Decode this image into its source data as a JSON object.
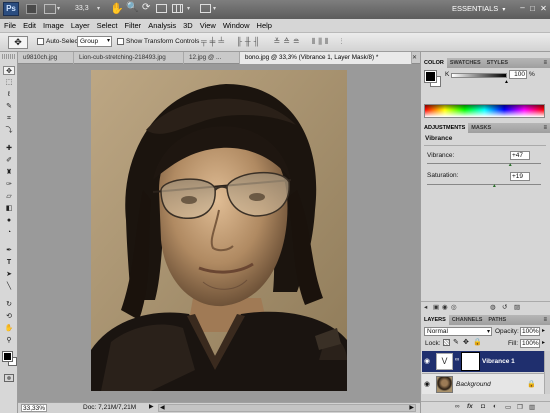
{
  "app": {
    "logo": "Ps",
    "zoom": "33,3",
    "workspace_button": "ESSENTIALS",
    "colors": {
      "appbar": "#6b6b6b",
      "logo_bg": "#2b4d80",
      "layer_selected": "#1f2f6e"
    }
  },
  "menu": [
    "File",
    "Edit",
    "Image",
    "Layer",
    "Select",
    "Filter",
    "Analysis",
    "3D",
    "View",
    "Window",
    "Help"
  ],
  "options": {
    "auto_select_label": "Auto-Select:",
    "auto_select_value": "Group",
    "transform_label": "Show Transform Controls"
  },
  "doc_tabs": [
    {
      "label": "u9810ch.jpg"
    },
    {
      "label": "Lion-cub-stretching-218493.jpg"
    },
    {
      "label": "12.jpg @ ..."
    },
    {
      "label": "bono.jpg @ 33,3% (Vibrance 1, Layer Mask/8) *"
    }
  ],
  "status": {
    "zoom": "33,33%",
    "doc": "Doc: 7,21M/7,21M"
  },
  "color_panel": {
    "tabs": [
      "COLOR",
      "SWATCHES",
      "STYLES"
    ],
    "channel": "K",
    "value": "100",
    "unit": "%",
    "k_fraction": 1.0
  },
  "adjustments": {
    "tabs": [
      "ADJUSTMENTS",
      "MASKS"
    ],
    "title": "Vibrance",
    "vibrance_label": "Vibrance:",
    "vibrance_value": "+47",
    "vibrance_fraction": 0.735,
    "saturation_label": "Saturation:",
    "saturation_value": "+19",
    "saturation_fraction": 0.595
  },
  "layers": {
    "tabs": [
      "LAYERS",
      "CHANNELS",
      "PATHS"
    ],
    "blend_mode": "Normal",
    "opacity_label": "Opacity:",
    "opacity": "100%",
    "lock_label": "Lock:",
    "fill_label": "Fill:",
    "fill": "100%",
    "items": [
      {
        "name": "Vibrance 1",
        "selected": true
      },
      {
        "name": "Background",
        "selected": false,
        "locked": true
      }
    ]
  },
  "icons": [
    "move-icon",
    "marquee-icon",
    "lasso-icon",
    "quick-select-icon",
    "crop-icon",
    "eyedropper-icon",
    "healing-icon",
    "brush-icon",
    "clone-stamp-icon",
    "history-brush-icon",
    "eraser-icon",
    "gradient-icon",
    "blur-icon",
    "dodge-icon",
    "pen-icon",
    "type-icon",
    "path-select-icon",
    "shape-icon",
    "3d-rotate-icon",
    "3d-camera-icon",
    "hand-icon",
    "zoom-icon"
  ]
}
